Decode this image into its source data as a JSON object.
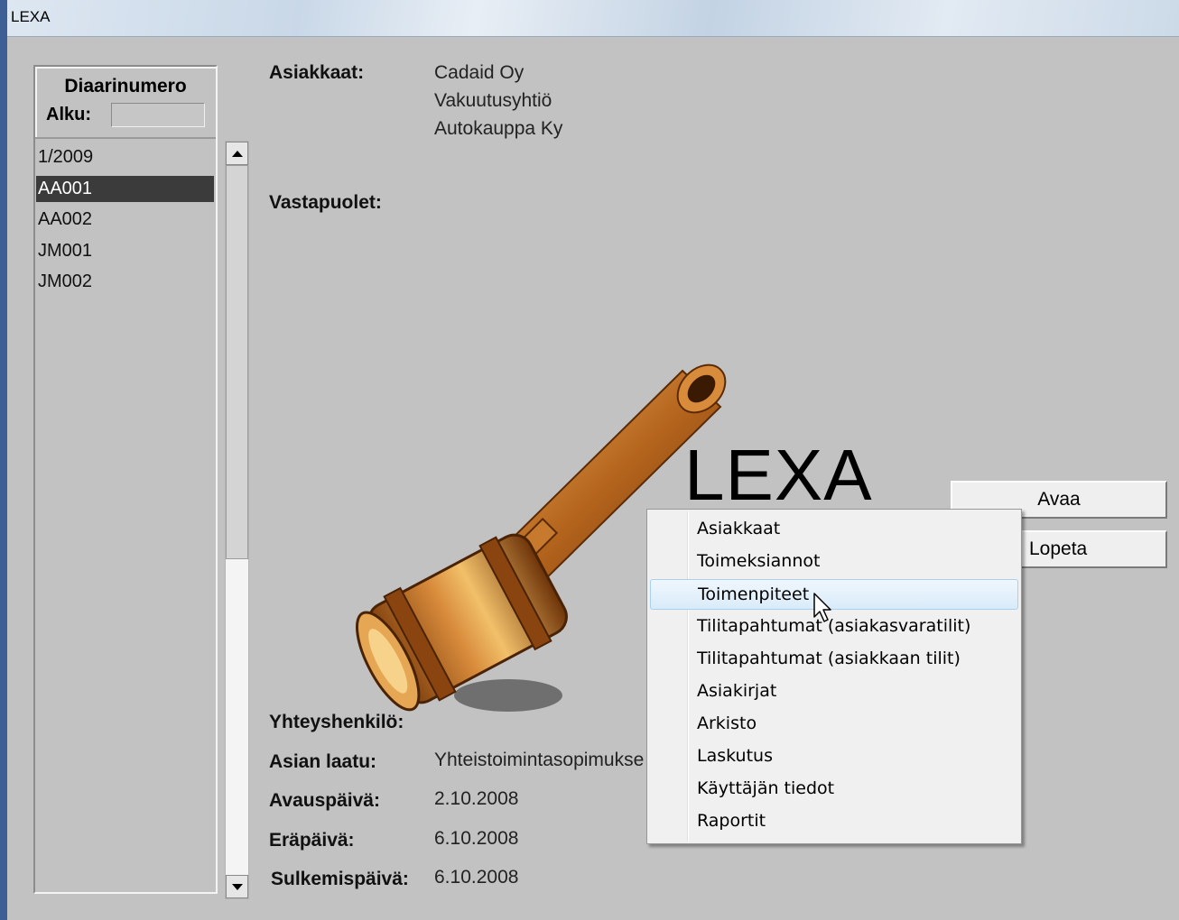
{
  "window": {
    "title": "LEXA"
  },
  "left_panel": {
    "heading": "Diaarinumero",
    "alku_label": "Alku:",
    "alku_value": "",
    "items": [
      "1/2009",
      "AA001",
      "AA002",
      "JM001",
      "JM002"
    ],
    "selected": "AA001"
  },
  "fields": {
    "asiakkaat_label": "Asiakkaat:",
    "asiakkaat_values": [
      "Cadaid Oy",
      "Vakuutusyhtiö",
      "Autokauppa Ky"
    ],
    "vastapuolet_label": "Vastapuolet:",
    "yhteyshenkilo_label": "Yhteyshenkilö:",
    "asian_laatu_label": "Asian laatu:",
    "asian_laatu_value": "Yhteistoimintasopimukse",
    "avauspaiva_label": "Avauspäivä:",
    "avauspaiva_value": "2.10.2008",
    "erapaiva_label": "Eräpäivä:",
    "erapaiva_value": "6.10.2008",
    "sulkemispaiva_label": "Sulkemispäivä:",
    "sulkemispaiva_value": "6.10.2008"
  },
  "logo": {
    "text": "LEXA"
  },
  "buttons": {
    "avaa": "Avaa",
    "lopeta": "Lopeta"
  },
  "context_menu": {
    "items": [
      "Asiakkaat",
      "Toimeksiannot",
      "Toimenpiteet",
      "Tilitapahtumat (asiakasvaratilit)",
      "Tilitapahtumat (asiakkaan tilit)",
      "Asiakirjat",
      "Arkisto",
      "Laskutus",
      "Käyttäjän tiedot",
      "Raportit"
    ],
    "hovered": "Toimenpiteet"
  },
  "icons": {
    "gavel": "gavel-icon",
    "scroll_up": "arrow-up-icon",
    "scroll_down": "arrow-down-icon",
    "cursor": "mouse-cursor-icon"
  },
  "colors": {
    "background": "#c2c2c2",
    "selected_row": "#3b3b3b",
    "menu_hover": "#d9ebf9",
    "gavel_wood": "#b5651d"
  }
}
